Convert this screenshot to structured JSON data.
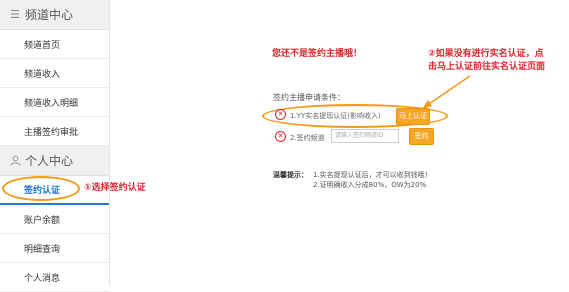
{
  "sidebar": {
    "channel_center": {
      "title": "频道中心",
      "items": [
        {
          "label": "频道首页"
        },
        {
          "label": "频道收入"
        },
        {
          "label": "频道收入明细"
        },
        {
          "label": "主播签约审批"
        }
      ]
    },
    "personal_center": {
      "title": "个人中心",
      "items": [
        {
          "label": "签约认证",
          "active": true
        },
        {
          "label": "账户余额"
        },
        {
          "label": "明细查询"
        },
        {
          "label": "个人消息"
        }
      ]
    }
  },
  "main": {
    "title": "您还不是签约主播哦！",
    "conditions_label": "签约主播申请条件：",
    "condition_1": {
      "text": "1.YY实名提现认证(影响收入)",
      "button": "马上认证"
    },
    "condition_2": {
      "text": "2.签约频道",
      "placeholder": "请输入签约频道ID",
      "button": "签约"
    },
    "tips": {
      "label": "温馨提示：",
      "line1": "1.实名提现认证后，才可以收到钱哦！",
      "line2": "2.证明确收入分成80%，OW为20%"
    }
  },
  "annotations": {
    "step1": "①选择签约认证",
    "step2_line1": "②如果没有进行实名认证，点",
    "step2_line2": "击马上认证前往实名认证页面"
  },
  "colors": {
    "accent_blue": "#1a72c9",
    "warning_red": "#d9272e",
    "button_orange": "#f6a623",
    "highlight_oval": "#f39a16"
  }
}
